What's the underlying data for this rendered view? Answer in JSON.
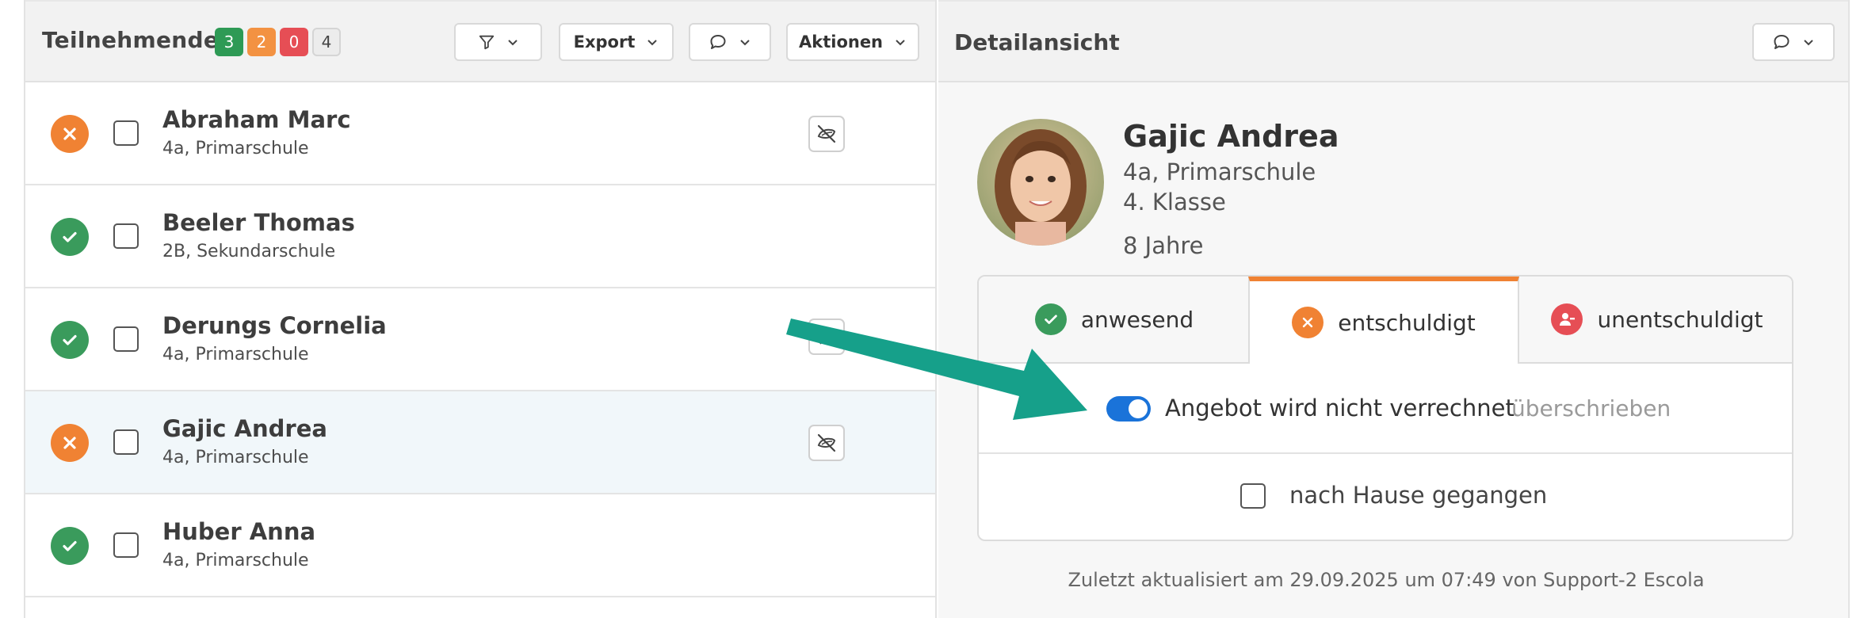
{
  "left_panel": {
    "title": "Teilnehmende",
    "badges": {
      "present": "3",
      "excused": "2",
      "unexcused": "0",
      "open": "4"
    },
    "toolbar": {
      "export_label": "Export",
      "actions_label": "Aktionen"
    },
    "participants": [
      {
        "name": "Abraham Marc",
        "sub": "4a, Primarschule",
        "status": "excused",
        "icon": "no-food-icon"
      },
      {
        "name": "Beeler Thomas",
        "sub": "2B, Sekundarschule",
        "status": "present",
        "icon": ""
      },
      {
        "name": "Derungs Cornelia",
        "sub": "4a, Primarschule",
        "status": "present",
        "icon": "leaf-icon"
      },
      {
        "name": "Gajic Andrea",
        "sub": "4a, Primarschule",
        "status": "excused",
        "icon": "no-food-icon"
      },
      {
        "name": "Huber Anna",
        "sub": "4a, Primarschule",
        "status": "present",
        "icon": ""
      }
    ]
  },
  "right_panel": {
    "title": "Detailansicht",
    "person": {
      "name": "Gajic Andrea",
      "class": "4a, Primarschule",
      "grade": "4. Klasse",
      "age": "8 Jahre"
    },
    "tabs": {
      "present": "anwesend",
      "excused": "entschuldigt",
      "unexcused": "unentschuldigt"
    },
    "toggle": {
      "label": "Angebot wird nicht verrechnet",
      "override": "überschrieben",
      "on": true
    },
    "home_checkbox_label": "nach Hause gegangen",
    "footer": "Zuletzt aktualisiert am 29.09.2025 um 07:49 von Support-2 Escola"
  },
  "colors": {
    "present": "#3a9b5c",
    "excused": "#f08233",
    "unexcused": "#e64e55",
    "toggle": "#1a73d9",
    "arrow": "#16a08a"
  }
}
